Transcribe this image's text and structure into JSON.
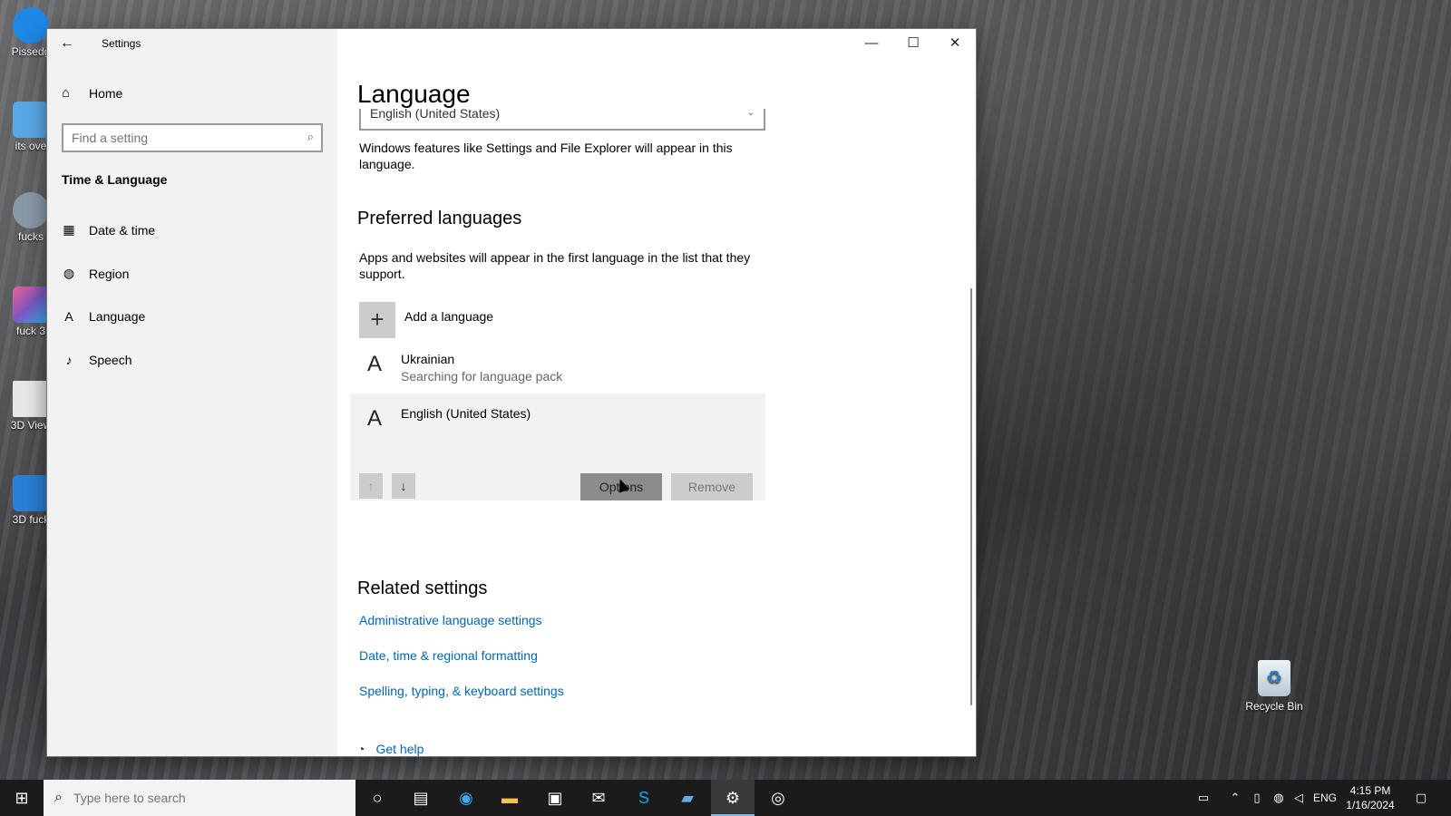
{
  "desktop": {
    "icons": [
      {
        "label": "Pissedg",
        "color": "#1e88e5"
      },
      {
        "label": "its ove",
        "color": "#5aa9e6"
      },
      {
        "label": "fucks",
        "color": "#8a9aa8"
      },
      {
        "label": "fuck 3",
        "color": "#c25bd8"
      },
      {
        "label": "3D View",
        "color": "#e8e8e8"
      },
      {
        "label": "3D fuck",
        "color": "#2a7fd6"
      }
    ],
    "recycle_bin": "Recycle Bin"
  },
  "window": {
    "title": "Settings",
    "back": "←",
    "controls": {
      "minimize": "—",
      "maximize": "☐",
      "close": "✕"
    }
  },
  "sidebar": {
    "home": "Home",
    "search_placeholder": "Find a setting",
    "section": "Time & Language",
    "items": [
      {
        "label": "Date & time",
        "icon": "calendar-clock-icon"
      },
      {
        "label": "Region",
        "icon": "globe-icon"
      },
      {
        "label": "Language",
        "icon": "language-icon"
      },
      {
        "label": "Speech",
        "icon": "microphone-icon"
      }
    ]
  },
  "main": {
    "title": "Language",
    "display_language": "English (United States)",
    "display_description": "Windows features like Settings and File Explorer will appear in this language.",
    "preferred_heading": "Preferred languages",
    "preferred_description": "Apps and websites will appear in the first language in the list that they support.",
    "add_language": "Add a language",
    "languages": [
      {
        "name": "Ukrainian",
        "status": "Searching for language pack"
      },
      {
        "name": "English (United States)",
        "status": ""
      }
    ],
    "options_button": "Options",
    "remove_button": "Remove",
    "related_heading": "Related settings",
    "related_links": [
      "Administrative language settings",
      "Date, time & regional formatting",
      "Spelling, typing, & keyboard settings"
    ],
    "get_help": "Get help"
  },
  "taskbar": {
    "search_placeholder": "Type here to search",
    "tray_language": "ENG",
    "time": "4:15 PM",
    "date": "1/16/2024"
  }
}
